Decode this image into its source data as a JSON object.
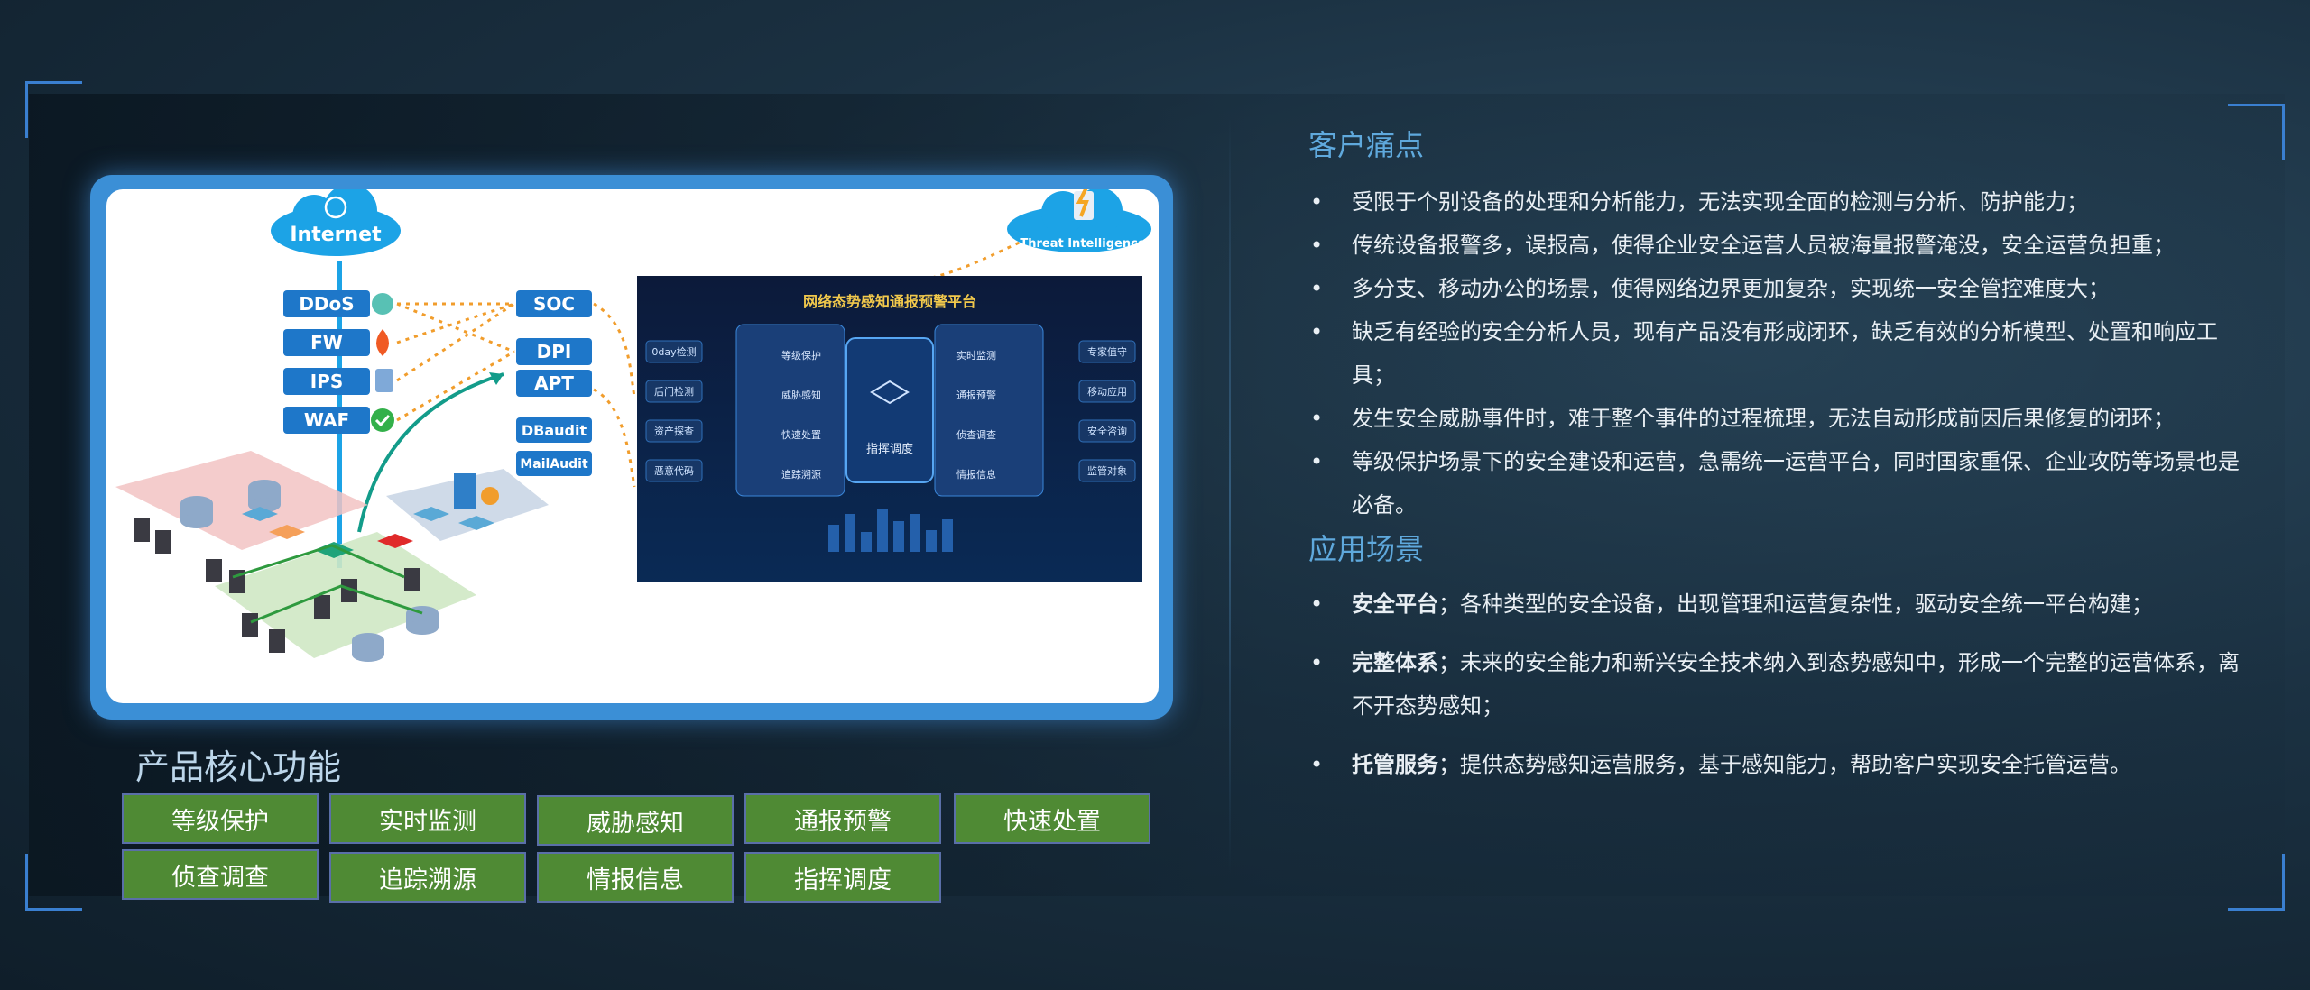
{
  "diagram": {
    "internet": "Internet",
    "threat": "Threat Intelligence",
    "devices_left": [
      "DDoS",
      "FW",
      "IPS",
      "WAF"
    ],
    "devices_mid": [
      "SOC",
      "DPI",
      "APT",
      "DBaudit",
      "MailAudit"
    ],
    "platform_title": "网络态势感知通报预警平台",
    "platform_left_tags": [
      "0day检测",
      "后门检测",
      "资产探查",
      "恶意代码"
    ],
    "platform_items_left": [
      "等级保护",
      "威胁感知",
      "快速处置",
      "追踪溯源"
    ],
    "platform_center": "指挥调度",
    "platform_items_right": [
      "实时监测",
      "通报预警",
      "侦查调查",
      "情报信息"
    ],
    "platform_right_tags": [
      "专家值守",
      "移动应用",
      "安全咨询",
      "监管对象"
    ]
  },
  "features": {
    "title": "产品核心功能",
    "items": [
      "等级保护",
      "实时监测",
      "威胁感知",
      "通报预警",
      "快速处置",
      "侦查调查",
      "追踪溯源",
      "情报信息",
      "指挥调度"
    ]
  },
  "pain_points": {
    "title": "客户痛点",
    "items": [
      "受限于个别设备的处理和分析能力，无法实现全面的检测与分析、防护能力；",
      "传统设备报警多，误报高，使得企业安全运营人员被海量报警淹没，安全运营负担重；",
      "多分支、移动办公的场景，使得网络边界更加复杂，实现统一安全管控难度大；",
      "缺乏有经验的安全分析人员，现有产品没有形成闭环，缺乏有效的分析模型、处置和响应工具；",
      "发生安全威胁事件时，难于整个事件的过程梳理，无法自动形成前因后果修复的闭环；",
      "等级保护场景下的安全建设和运营，急需统一运营平台，同时国家重保、企业攻防等场景也是必备。"
    ]
  },
  "scenarios": {
    "title": "应用场景",
    "items": [
      {
        "bold": "安全平台",
        "text": "；各种类型的安全设备，出现管理和运营复杂性，驱动安全统一平台构建；"
      },
      {
        "bold": "完整体系",
        "text": "；未来的安全能力和新兴安全技术纳入到态势感知中，形成一个完整的运营体系，离不开态势感知；"
      },
      {
        "bold": "托管服务",
        "text": "；提供态势感知运营服务，基于感知能力，帮助客户实现安全托管运营。"
      }
    ]
  }
}
